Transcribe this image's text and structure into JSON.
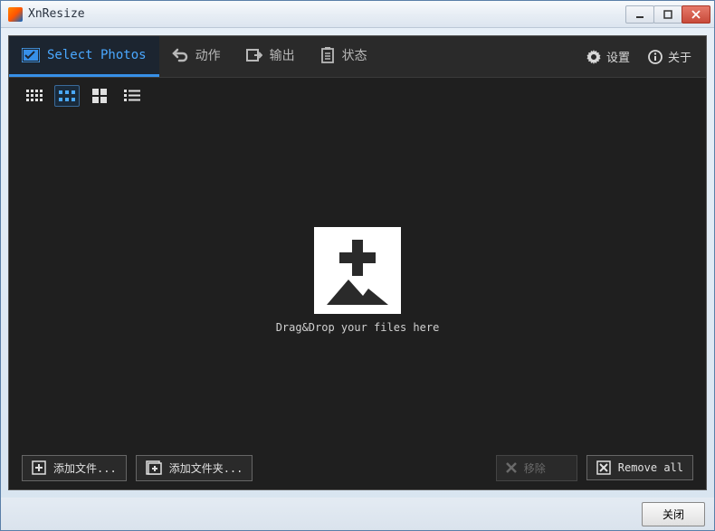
{
  "window": {
    "title": "XnResize"
  },
  "tabs": {
    "select_photos": "Select Photos",
    "action": "动作",
    "output": "输出",
    "status": "状态"
  },
  "rightmenu": {
    "settings": "设置",
    "about": "关于"
  },
  "dropzone": {
    "text": "Drag&Drop your files here"
  },
  "buttons": {
    "add_files": "添加文件...",
    "add_folder": "添加文件夹...",
    "remove": "移除",
    "remove_all": "Remove all"
  },
  "footer": {
    "close": "关闭"
  }
}
